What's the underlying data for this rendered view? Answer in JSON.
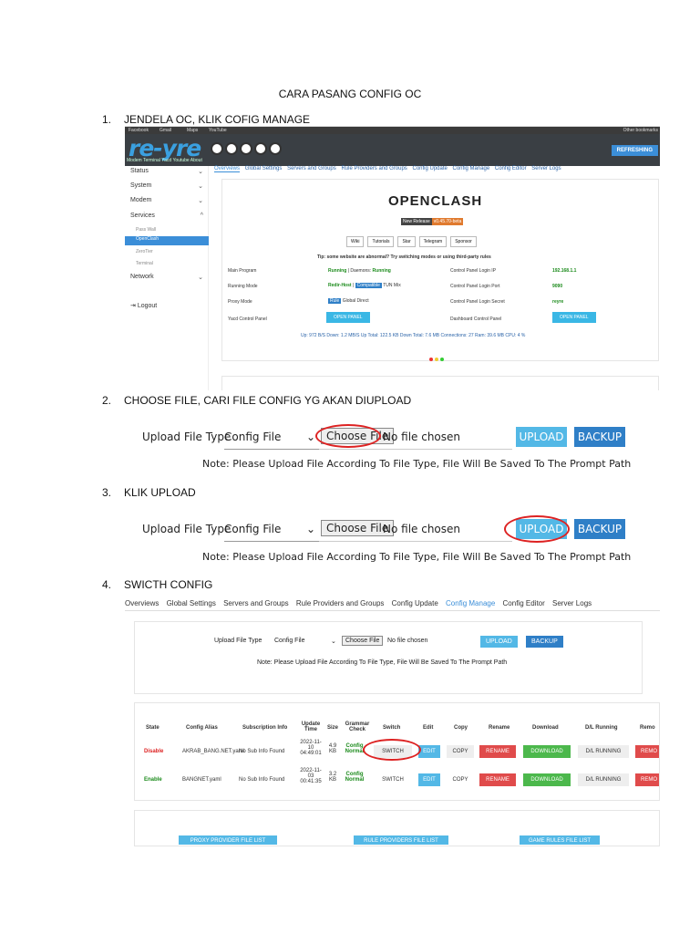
{
  "doc": {
    "title": "CARA PASANG CONFIG OC",
    "steps": [
      {
        "num": "1.",
        "text": "JENDELA OC, KLIK COFIG MANAGE"
      },
      {
        "num": "2.",
        "text": "CHOOSE FILE, CARI FILE CONFIG YG AKAN DIUPLOAD"
      },
      {
        "num": "3.",
        "text": "KLIK UPLOAD"
      },
      {
        "num": "4.",
        "text": "SWICTH CONFIG"
      }
    ]
  },
  "shot1": {
    "bookmarks": [
      "Facebook",
      "Gmail",
      "Maps",
      "YouTube"
    ],
    "bookmark_right": "Other bookmarks",
    "brand": "re-yre",
    "subnav": "Modem  Terminal  Yacd  Youtube  About",
    "refresh": "REFRESHING",
    "sidebar": {
      "status": "Status",
      "system": "System",
      "modem": "Modem",
      "services": "Services",
      "passwall": "Pass Wall",
      "openclash": "OpenClash",
      "zerotier": "ZeroTier",
      "terminal": "Terminal",
      "network": "Network",
      "logout": "Logout"
    },
    "tabs": [
      "Overviews",
      "Global Settings",
      "Servers and Groups",
      "Rule Providers and Groups",
      "Config Update",
      "Config Manage",
      "Config Editor",
      "Server Logs"
    ],
    "oc_logo": "OPENCLASH",
    "release_label": "New Release",
    "release_ver": "v0.45.70-beta",
    "buttons": [
      "Wiki",
      "Tutorials",
      "Star",
      "Telegram",
      "Sponsor"
    ],
    "tip": "Tip: some website are abnormal? Try switching modes or using third-party rules",
    "rows": {
      "main_program": "Main Program",
      "running": "Running",
      "daemons": "| Daemons:",
      "running2": "Running",
      "login_ip_label": "Control Panel Login IP",
      "login_ip": "192.168.1.1",
      "running_mode": "Running Mode",
      "redir": "Redir-Host",
      "compat": "Compatible",
      "tun": "TUN",
      "mix": "Mix",
      "login_port_label": "Control Panel Login Port",
      "login_port": "9090",
      "proxy_mode": "Proxy Mode",
      "rule": "Rule",
      "global": "Global",
      "direct": "Direct",
      "secret_label": "Control Panel Login Secret",
      "secret": "reyre",
      "yacd": "Yacd Control Panel",
      "open1": "OPEN PANEL",
      "dashboard": "Dashboard Control Panel",
      "open2": "OPEN PANEL"
    },
    "stats": "Up: 972 B/S   Down: 1.2 MB/S   Up Total: 122.5 KB   Down Total: 7.6 MB   Connections: 27   Ram: 39.6 MB   CPU: 4 %"
  },
  "upload": {
    "label": "Upload File Type",
    "select": "Config File",
    "choose": "Choose File",
    "nofile": "No file chosen",
    "upload_btn": "UPLOAD",
    "backup_btn": "BACKUP",
    "note": "Note: Please Upload File According To File Type, File Will Be Saved To The Prompt Path"
  },
  "shot4": {
    "tabs": [
      "Overviews",
      "Global Settings",
      "Servers and Groups",
      "Rule Providers and Groups",
      "Config Update",
      "Config Manage",
      "Config Editor",
      "Server Logs"
    ],
    "headers": [
      "State",
      "Config Alias",
      "Subscription Info",
      "Update Time",
      "Size",
      "Grammar Check",
      "Switch",
      "Edit",
      "Copy",
      "Rename",
      "Download",
      "D/L Running",
      "Remo"
    ],
    "rows": [
      {
        "state": "Disable",
        "alias": "AKRAB_BANG.NET.yaml",
        "sub": "No Sub Info Found",
        "time": "2022-11-10 04:49:01",
        "size": "4.9 KB",
        "grammar": "Config Normal",
        "switch": "SWITCH",
        "edit": "EDIT",
        "copy": "COPY",
        "rename": "RENAME",
        "download": "DOWNLOAD",
        "dl": "D/L RUNNING",
        "remove": "REMO"
      },
      {
        "state": "Enable",
        "alias": "BANGNET.yaml",
        "sub": "No Sub Info Found",
        "time": "2022-11-03 00:41:35",
        "size": "3.2 KB",
        "grammar": "Config Normal",
        "switch": "SWITCH",
        "edit": "EDIT",
        "copy": "COPY",
        "rename": "RENAME",
        "download": "DOWNLOAD",
        "dl": "D/L RUNNING",
        "remove": "REMO"
      }
    ],
    "footer_buttons": [
      "PROXY PROVIDER FILE LIST",
      "RULE PROVIDERS FILE LIST",
      "GAME RULES FILE LIST"
    ]
  },
  "colors": {
    "red_circle": "#dd2222",
    "upload": "#53b8e6",
    "backup": "#2f7fc7",
    "rename": "#e04b4b",
    "download": "#4cb84c",
    "edit": "#53b8e6"
  }
}
